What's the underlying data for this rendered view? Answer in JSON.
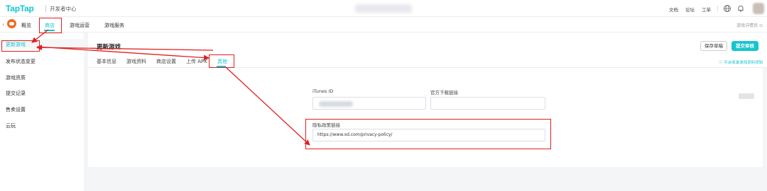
{
  "topbar": {
    "logo": "TapTap",
    "portal": "开发者中心",
    "links": [
      "文档",
      "论坛",
      "工单"
    ]
  },
  "subnav": {
    "tabs": [
      "概览",
      "商店",
      "游戏运营",
      "游戏服务"
    ],
    "active_tab": "商店",
    "detail_link": "游戏详情页 ⊙"
  },
  "sidebar": {
    "items": [
      "更新游戏",
      "发布状态变更",
      "游戏资质",
      "提交记录",
      "售卖设置",
      "云玩"
    ],
    "active_item": "更新游戏"
  },
  "main": {
    "title": "更新游戏",
    "tabs": [
      "基本信息",
      "游戏资料",
      "商店设置",
      "上传 APK",
      "其他"
    ],
    "active_tab": "其他",
    "save_label": "保存草稿",
    "submit_label": "提交审核",
    "notice": "ⓘ 平台收录游戏资料须知"
  },
  "form": {
    "itunes_label": "iTunes ID",
    "official_label": "官方下载链接",
    "privacy_label": "隐私政策链接",
    "privacy_value": "https://www.xd.com/privacy-policy/"
  },
  "colors": {
    "accent": "#15c5ce",
    "annotation": "#e02020"
  }
}
